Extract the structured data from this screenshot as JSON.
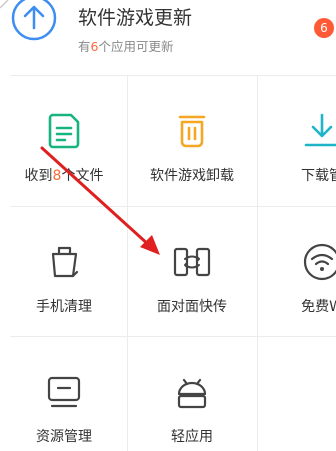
{
  "update": {
    "title": "软件游戏更新",
    "subtitle_prefix": "有",
    "subtitle_count": "6",
    "subtitle_suffix": "个应用可更新",
    "badge": "6",
    "icon": "upload-arrow-icon"
  },
  "tiles": [
    {
      "label_prefix": "收到",
      "label_count": "8",
      "label_suffix": "个文件",
      "icon": "file-received-icon",
      "color": "#19b37d"
    },
    {
      "label": "软件游戏卸载",
      "icon": "trash-icon",
      "color": "#f5a623"
    },
    {
      "label": "下载管",
      "icon": "download-icon",
      "color": "#1fb5c9"
    },
    {
      "label": "手机清理",
      "icon": "phone-clean-icon",
      "color": "#444444"
    },
    {
      "label": "面对面快传",
      "icon": "face-to-face-transfer-icon",
      "color": "#444444"
    },
    {
      "label": "免费W",
      "icon": "wifi-icon",
      "color": "#444444"
    },
    {
      "label": "资源管理",
      "icon": "resource-manager-icon",
      "color": "#444444"
    },
    {
      "label": "轻应用",
      "icon": "android-light-app-icon",
      "color": "#444444"
    }
  ],
  "colors": {
    "accent": "#ff6a3c",
    "badge": "#ff5a35",
    "annotation_arrow": "#e02020",
    "divider": "#ececec"
  }
}
